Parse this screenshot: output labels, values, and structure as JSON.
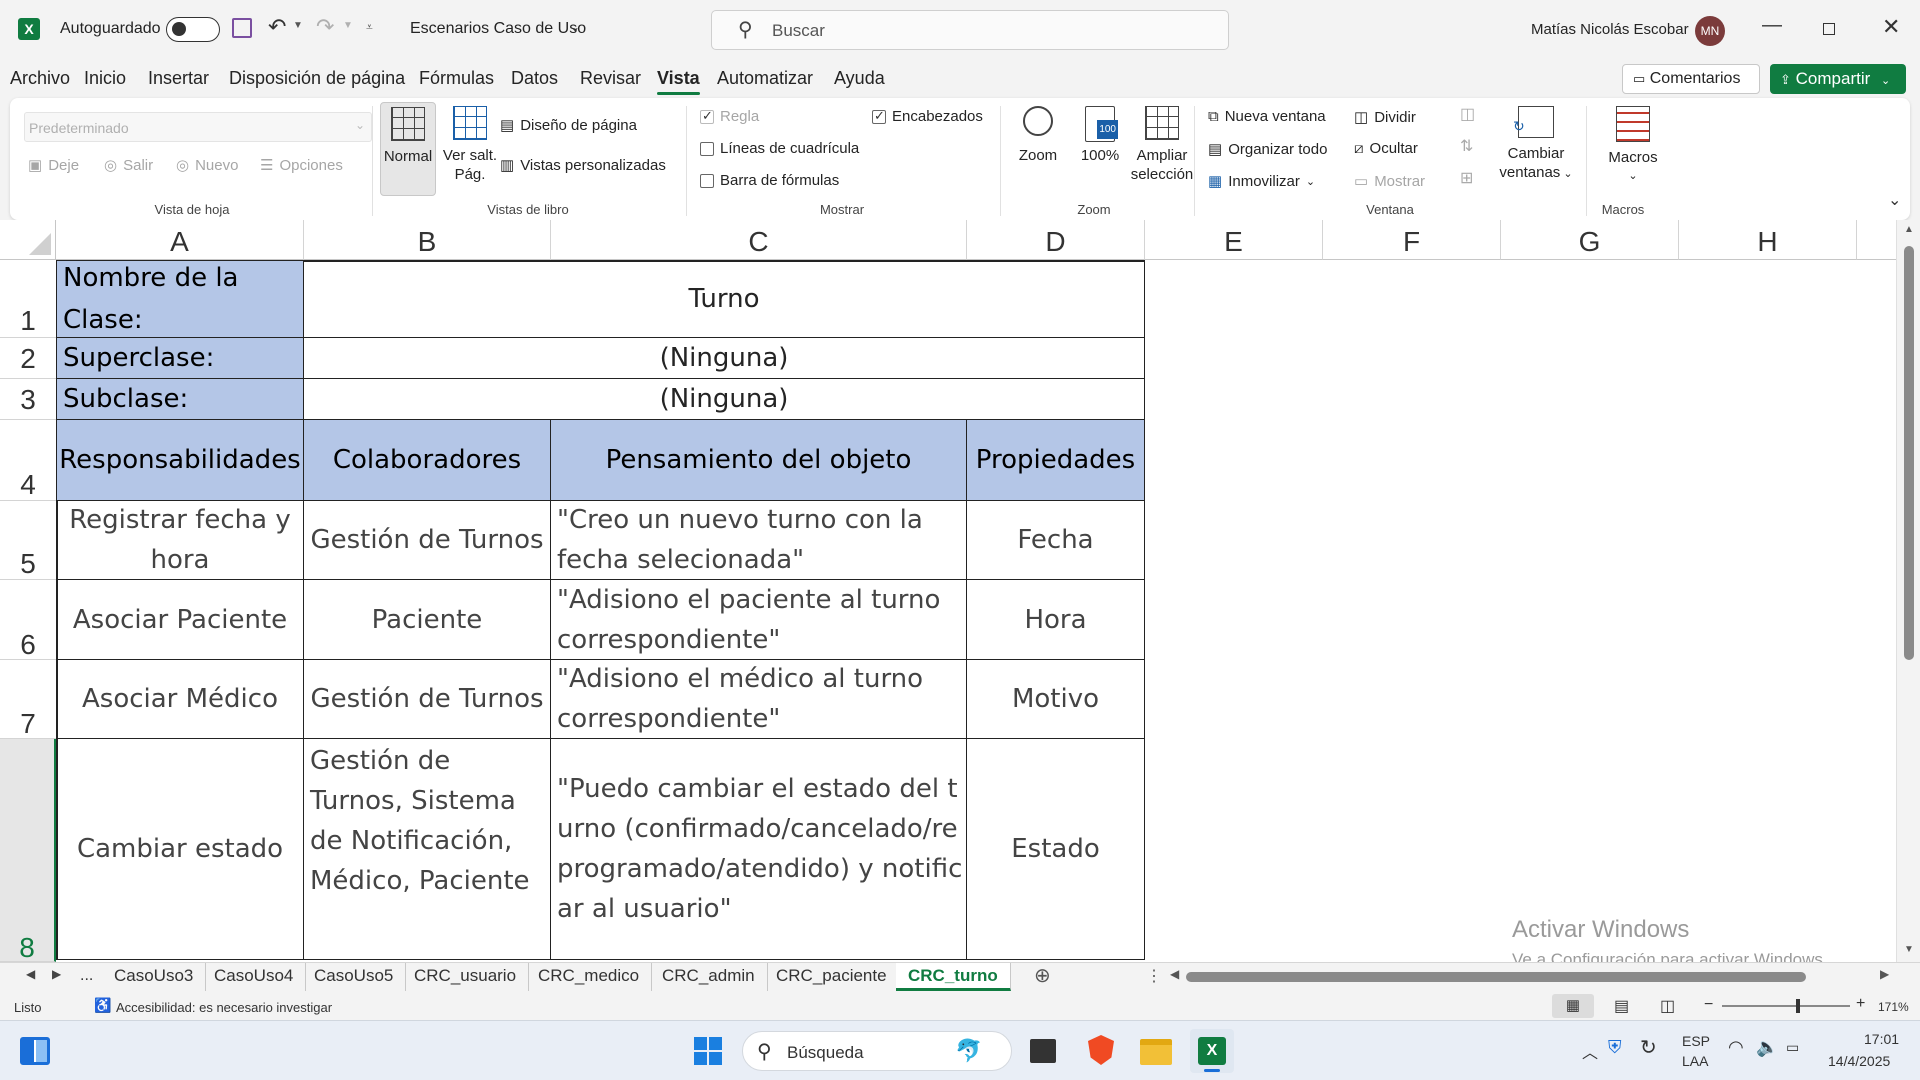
{
  "titlebar": {
    "autosave_label": "Autoguardado",
    "doc_title": "Escenarios Caso de Uso",
    "search_placeholder": "Buscar",
    "user_name": "Matías Nicolás Escobar",
    "user_initials": "MN"
  },
  "menu": {
    "items": [
      "Archivo",
      "Inicio",
      "Insertar",
      "Disposición de página",
      "Fórmulas",
      "Datos",
      "Revisar",
      "Vista",
      "Automatizar",
      "Ayuda"
    ],
    "active": "Vista",
    "comments": "Comentarios",
    "share": "Compartir"
  },
  "ribbon": {
    "sheet_view": {
      "dropdown": "Predeterminado",
      "keep": "Deje",
      "exit": "Salir",
      "new": "Nuevo",
      "options": "Opciones",
      "label": "Vista de hoja"
    },
    "workbook_views": {
      "normal": "Normal",
      "page_break_1": "Ver salt.",
      "page_break_2": "Pág.",
      "page_layout": "Diseño de página",
      "custom_views": "Vistas personalizadas",
      "label": "Vistas de libro"
    },
    "show": {
      "ruler": "Regla",
      "headings": "Encabezados",
      "gridlines": "Líneas de cuadrícula",
      "formula_bar": "Barra de fórmulas",
      "label": "Mostrar"
    },
    "zoom": {
      "zoom": "Zoom",
      "zoom100": "100%",
      "zoom_sel_1": "Ampliar",
      "zoom_sel_2": "selección",
      "label": "Zoom"
    },
    "window": {
      "new_window": "Nueva ventana",
      "arrange_all": "Organizar todo",
      "freeze": "Inmovilizar",
      "split": "Dividir",
      "hide": "Ocultar",
      "unhide": "Mostrar",
      "switch_1": "Cambiar",
      "switch_2": "ventanas",
      "label": "Ventana"
    },
    "macros": {
      "macros": "Macros",
      "label": "Macros"
    }
  },
  "sheet": {
    "columns": [
      "A",
      "B",
      "C",
      "D",
      "E",
      "F",
      "G",
      "H"
    ],
    "rows": [
      "1",
      "2",
      "3",
      "4",
      "5",
      "6",
      "7",
      "8"
    ],
    "class_name_label": "Nombre de la Clase:",
    "class_name": "Turno",
    "superclass_label": "Superclase:",
    "superclass": "(Ninguna)",
    "subclass_label": "Subclase:",
    "subclass": "(Ninguna)",
    "headers": [
      "Responsabilidades",
      "Colaboradores",
      "Pensamiento del objeto",
      "Propiedades"
    ],
    "table": [
      [
        "Registrar fecha y hora",
        "Gestión de Turnos",
        "\"Creo un nuevo turno con la fecha selecionada\"",
        "Fecha"
      ],
      [
        "Asociar Paciente",
        "Paciente",
        "\"Adisiono el paciente al turno correspondiente\"",
        "Hora"
      ],
      [
        "Asociar Médico",
        "Gestión de Turnos",
        "\"Adisiono el médico al turno correspondiente\"",
        "Motivo"
      ],
      [
        "Cambiar estado",
        "Gestión de Turnos, Sistema de Notificación, Médico, Paciente",
        "\"Puedo cambiar el estado del turno (confirmado/cancelado/reprogramado/atendido) y notificar al usuario\"",
        "Estado"
      ]
    ]
  },
  "watermark": {
    "line1": "Activar Windows",
    "line2": "Ve a Configuración para activar Windows."
  },
  "tabs": {
    "items": [
      "CasoUso3",
      "CasoUso4",
      "CasoUso5",
      "CRC_usuario",
      "CRC_medico",
      "CRC_admin",
      "CRC_paciente",
      "CRC_turno"
    ],
    "active": "CRC_turno",
    "ellipsis": "..."
  },
  "status": {
    "ready": "Listo",
    "accessibility": "Accesibilidad: es necesario investigar",
    "zoom": "171%"
  },
  "taskbar": {
    "search": "Búsqueda",
    "lang1": "ESP",
    "lang2": "LAA",
    "time": "17:01",
    "date": "14/4/2025"
  },
  "colors": {
    "accent": "#107c41",
    "header_fill": "#b4c6e7"
  }
}
